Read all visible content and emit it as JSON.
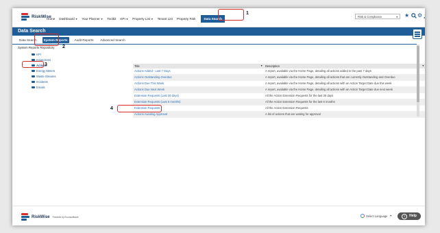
{
  "brand": {
    "name": "RiskWise",
    "footer_name": "RiskWise",
    "powered_by": "Powered by Ecomsoftware"
  },
  "nav": {
    "items": [
      {
        "label": "Home",
        "caret": false
      },
      {
        "label": "Dashboard",
        "caret": true
      },
      {
        "label": "Your Planner",
        "caret": true
      },
      {
        "label": "Toolkit",
        "caret": false
      },
      {
        "label": "KPI",
        "caret": true
      },
      {
        "label": "Property List",
        "caret": true
      },
      {
        "label": "Tenant List",
        "caret": false
      },
      {
        "label": "Property Risk",
        "caret": false
      }
    ],
    "active": "Data Search"
  },
  "category_select": {
    "value": "Risk & Compliance"
  },
  "icons": [
    "star-icon",
    "search-icon",
    "gear-icon",
    "user-icon"
  ],
  "page_title": "Data Search",
  "tabs": [
    "Data Search",
    "System Reports",
    "Audit Reports",
    "Advanced Search"
  ],
  "selected_tab": "System Reports",
  "repository_title": "System Reports Repository",
  "tree": [
    {
      "label": "KPI",
      "selected": false
    },
    {
      "label": "Inspections",
      "selected": false
    },
    {
      "label": "Actions",
      "selected": true
    },
    {
      "label": "Energy Meters",
      "selected": false
    },
    {
      "label": "Waste Streams",
      "selected": false
    },
    {
      "label": "Incidents",
      "selected": false
    },
    {
      "label": "Emails",
      "selected": false
    }
  ],
  "table": {
    "headers": [
      "Title",
      "Description"
    ],
    "rows": [
      {
        "title": "Actions Added - Last 7 Days",
        "description": "A report, available via the Home Page, detailing all actions added in the past 7 days"
      },
      {
        "title": "Actions Outstanding Overdue",
        "description": "A report, available via the Home Page, detailing all actions that are currently Outstanding and Overdue"
      },
      {
        "title": "Actions Due This Week",
        "description": "A report, available via the Home Page, detailing all actions with an Action Target Date due this week"
      },
      {
        "title": "Actions Due Next Week",
        "description": "A report, available via the Home Page, detailing all actions with an Action Target Date due next week"
      },
      {
        "title": "Extension Requests (Last 30 days)",
        "description": "All the Action Extension Requests for the last 30 days"
      },
      {
        "title": "Extension Requests (Last 6 months)",
        "description": "All the Action Extension Requests for the last 6 months"
      },
      {
        "title": "Extension Requests",
        "description": "All the Action Extension Requests"
      },
      {
        "title": "Actions Awaiting Approval",
        "description": "A list of actions that are waiting for approval"
      }
    ]
  },
  "steps": [
    "1",
    "2",
    "3",
    "4"
  ],
  "footer": {
    "language": "Select Language",
    "help": "Help"
  },
  "colors": {
    "primary": "#1f5d99",
    "highlight": "#d72b2b",
    "link": "#2a6fb4"
  }
}
